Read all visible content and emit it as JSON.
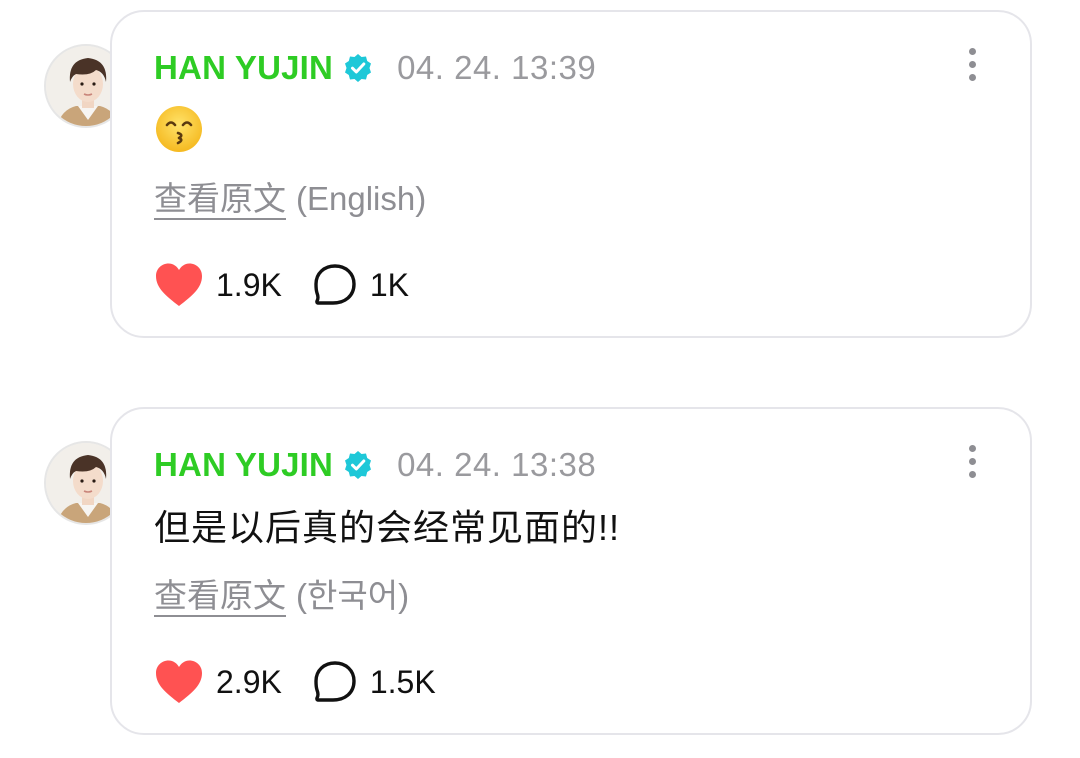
{
  "posts": [
    {
      "author": "HAN YUJIN",
      "timestamp": "04. 24. 13:39",
      "content_type": "emoji",
      "content": "😙",
      "translate_link": "查看原文",
      "translate_lang": "(English)",
      "likes": "1.9K",
      "comments": "1K"
    },
    {
      "author": "HAN YUJIN",
      "timestamp": "04. 24. 13:38",
      "content_type": "text",
      "content": "但是以后真的会经常见面的!!",
      "translate_link": "查看原文",
      "translate_lang": "(한국어)",
      "likes": "2.9K",
      "comments": "1.5K"
    }
  ],
  "colors": {
    "author_name": "#2ecc24",
    "verified_badge": "#1ec8d8",
    "timestamp": "#9a9a9e",
    "like_heart": "#ff5252",
    "card_border": "#e5e5ea"
  },
  "icons": [
    "avatar",
    "verified-badge-icon",
    "more-options-icon",
    "heart-icon",
    "comment-bubble-icon"
  ]
}
